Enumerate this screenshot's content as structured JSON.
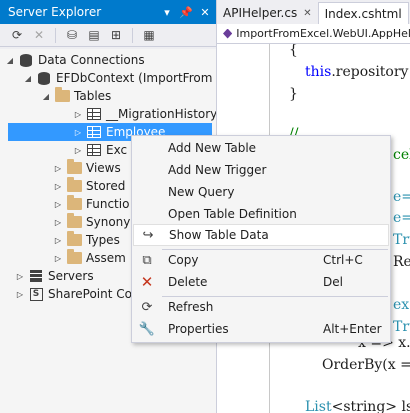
{
  "server_explorer": {
    "title": "Server Explorer",
    "title_buttons": [
      "▾",
      "⊕",
      "✕"
    ],
    "toolbar": {
      "refresh": "refresh-icon",
      "stop": "stop-icon",
      "connect_db": "connect-database-icon",
      "connect_server": "connect-server-icon",
      "connect_sharepoint": "connect-sharepoint-icon",
      "properties": "properties-icon"
    },
    "tree": {
      "data_connections": "Data Connections",
      "context": "EFDbContext (ImportFrom",
      "tables": "Tables",
      "migration_history": "__MigrationHistory",
      "employee": "Employee",
      "exc": "Exc",
      "views": "Views",
      "stored": "Stored",
      "functions": "Functio",
      "synonyms": "Synony",
      "types": "Types",
      "assemblies": "Assem",
      "servers": "Servers",
      "sharepoint": "SharePoint Co"
    }
  },
  "editor": {
    "tabs": [
      {
        "label": "APIHelper.cs",
        "active": false
      },
      {
        "label": "Index.cshtml",
        "active": true
      }
    ],
    "navbar": "ImportFromExcel.WebUI.AppHel",
    "code": {
      "brace_open": "{",
      "this_kw": "this",
      "this_rest": ".repository =",
      "brace_close": "}",
      "comment": "//",
      "cel": "cel",
      "e1": "e=",
      "e2": "e=",
      "tru": "Tru",
      "re": "Re",
      "ex": "ex",
      "tru2": "Tru",
      "x_expr": "x => x.F",
      "order": "OrderBy(x =",
      "list_type": "List",
      "list_rest": "<string> lst"
    }
  },
  "context_menu": {
    "items": [
      {
        "label": "Add New Table",
        "shortcut": "",
        "icon": ""
      },
      {
        "label": "Add New Trigger",
        "shortcut": "",
        "icon": ""
      },
      {
        "label": "New Query",
        "shortcut": "",
        "icon": ""
      },
      {
        "label": "Open Table Definition",
        "shortcut": "",
        "icon": ""
      },
      {
        "label": "Show Table Data",
        "shortcut": "",
        "icon": "↪"
      },
      {
        "label": "Copy",
        "shortcut": "Ctrl+C",
        "icon": "⧉"
      },
      {
        "label": "Delete",
        "shortcut": "Del",
        "icon": "✕"
      },
      {
        "label": "Refresh",
        "shortcut": "",
        "icon": "⟳"
      },
      {
        "label": "Properties",
        "shortcut": "Alt+Enter",
        "icon": "🔧"
      }
    ]
  }
}
